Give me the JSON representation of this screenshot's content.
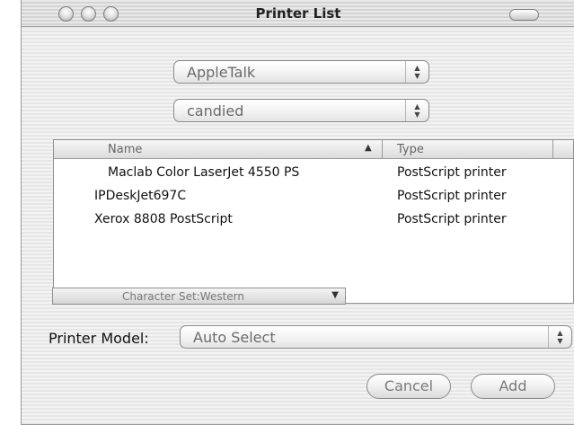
{
  "window": {
    "title": "Printer List"
  },
  "connection_popup": {
    "value": "AppleTalk"
  },
  "zone_popup": {
    "value": "candied"
  },
  "printer_table": {
    "columns": [
      "Name",
      "Type"
    ],
    "sort_column": "Name",
    "sort_direction": "ascending",
    "rows": [
      {
        "name": " Maclab Color LaserJet 4550 PS",
        "type": "PostScript printer"
      },
      {
        "name": "IPDeskJet697C",
        "type": "PostScript printer"
      },
      {
        "name": "Xerox 8808 PostScript",
        "type": "PostScript printer"
      }
    ]
  },
  "character_set": {
    "value": "Character Set:Western"
  },
  "printer_model": {
    "label": "Printer Model:",
    "value": "Auto Select"
  },
  "buttons": {
    "cancel_label": "Cancel",
    "add_label": "Add"
  }
}
